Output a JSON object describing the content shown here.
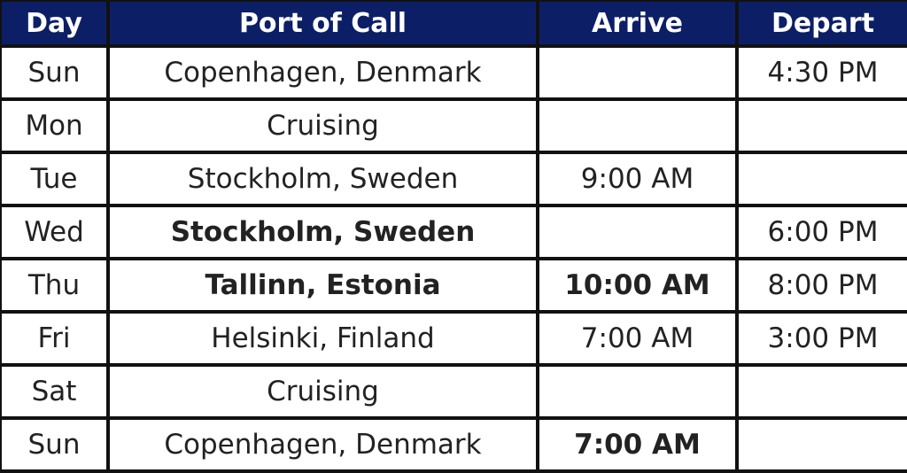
{
  "header_color": "#0c1f66",
  "columns": [
    "Day",
    "Port of Call",
    "Arrive",
    "Depart"
  ],
  "rows": [
    {
      "day": "Sun",
      "port": "Copenhagen, Denmark",
      "arrive": "",
      "depart": "4:30 PM",
      "bold": []
    },
    {
      "day": "Mon",
      "port": "Cruising",
      "arrive": "",
      "depart": "",
      "bold": []
    },
    {
      "day": "Tue",
      "port": "Stockholm, Sweden",
      "arrive": "9:00 AM",
      "depart": "",
      "bold": []
    },
    {
      "day": "Wed",
      "port": "Stockholm, Sweden",
      "arrive": "",
      "depart": "6:00 PM",
      "bold": [
        "port"
      ]
    },
    {
      "day": "Thu",
      "port": "Tallinn, Estonia",
      "arrive": "10:00 AM",
      "depart": "8:00 PM",
      "bold": [
        "port",
        "arrive"
      ]
    },
    {
      "day": "Fri",
      "port": "Helsinki, Finland",
      "arrive": "7:00 AM",
      "depart": "3:00 PM",
      "bold": []
    },
    {
      "day": "Sat",
      "port": "Cruising",
      "arrive": "",
      "depart": "",
      "bold": []
    },
    {
      "day": "Sun",
      "port": "Copenhagen, Denmark",
      "arrive": "7:00 AM",
      "depart": "",
      "bold": [
        "arrive"
      ]
    }
  ]
}
